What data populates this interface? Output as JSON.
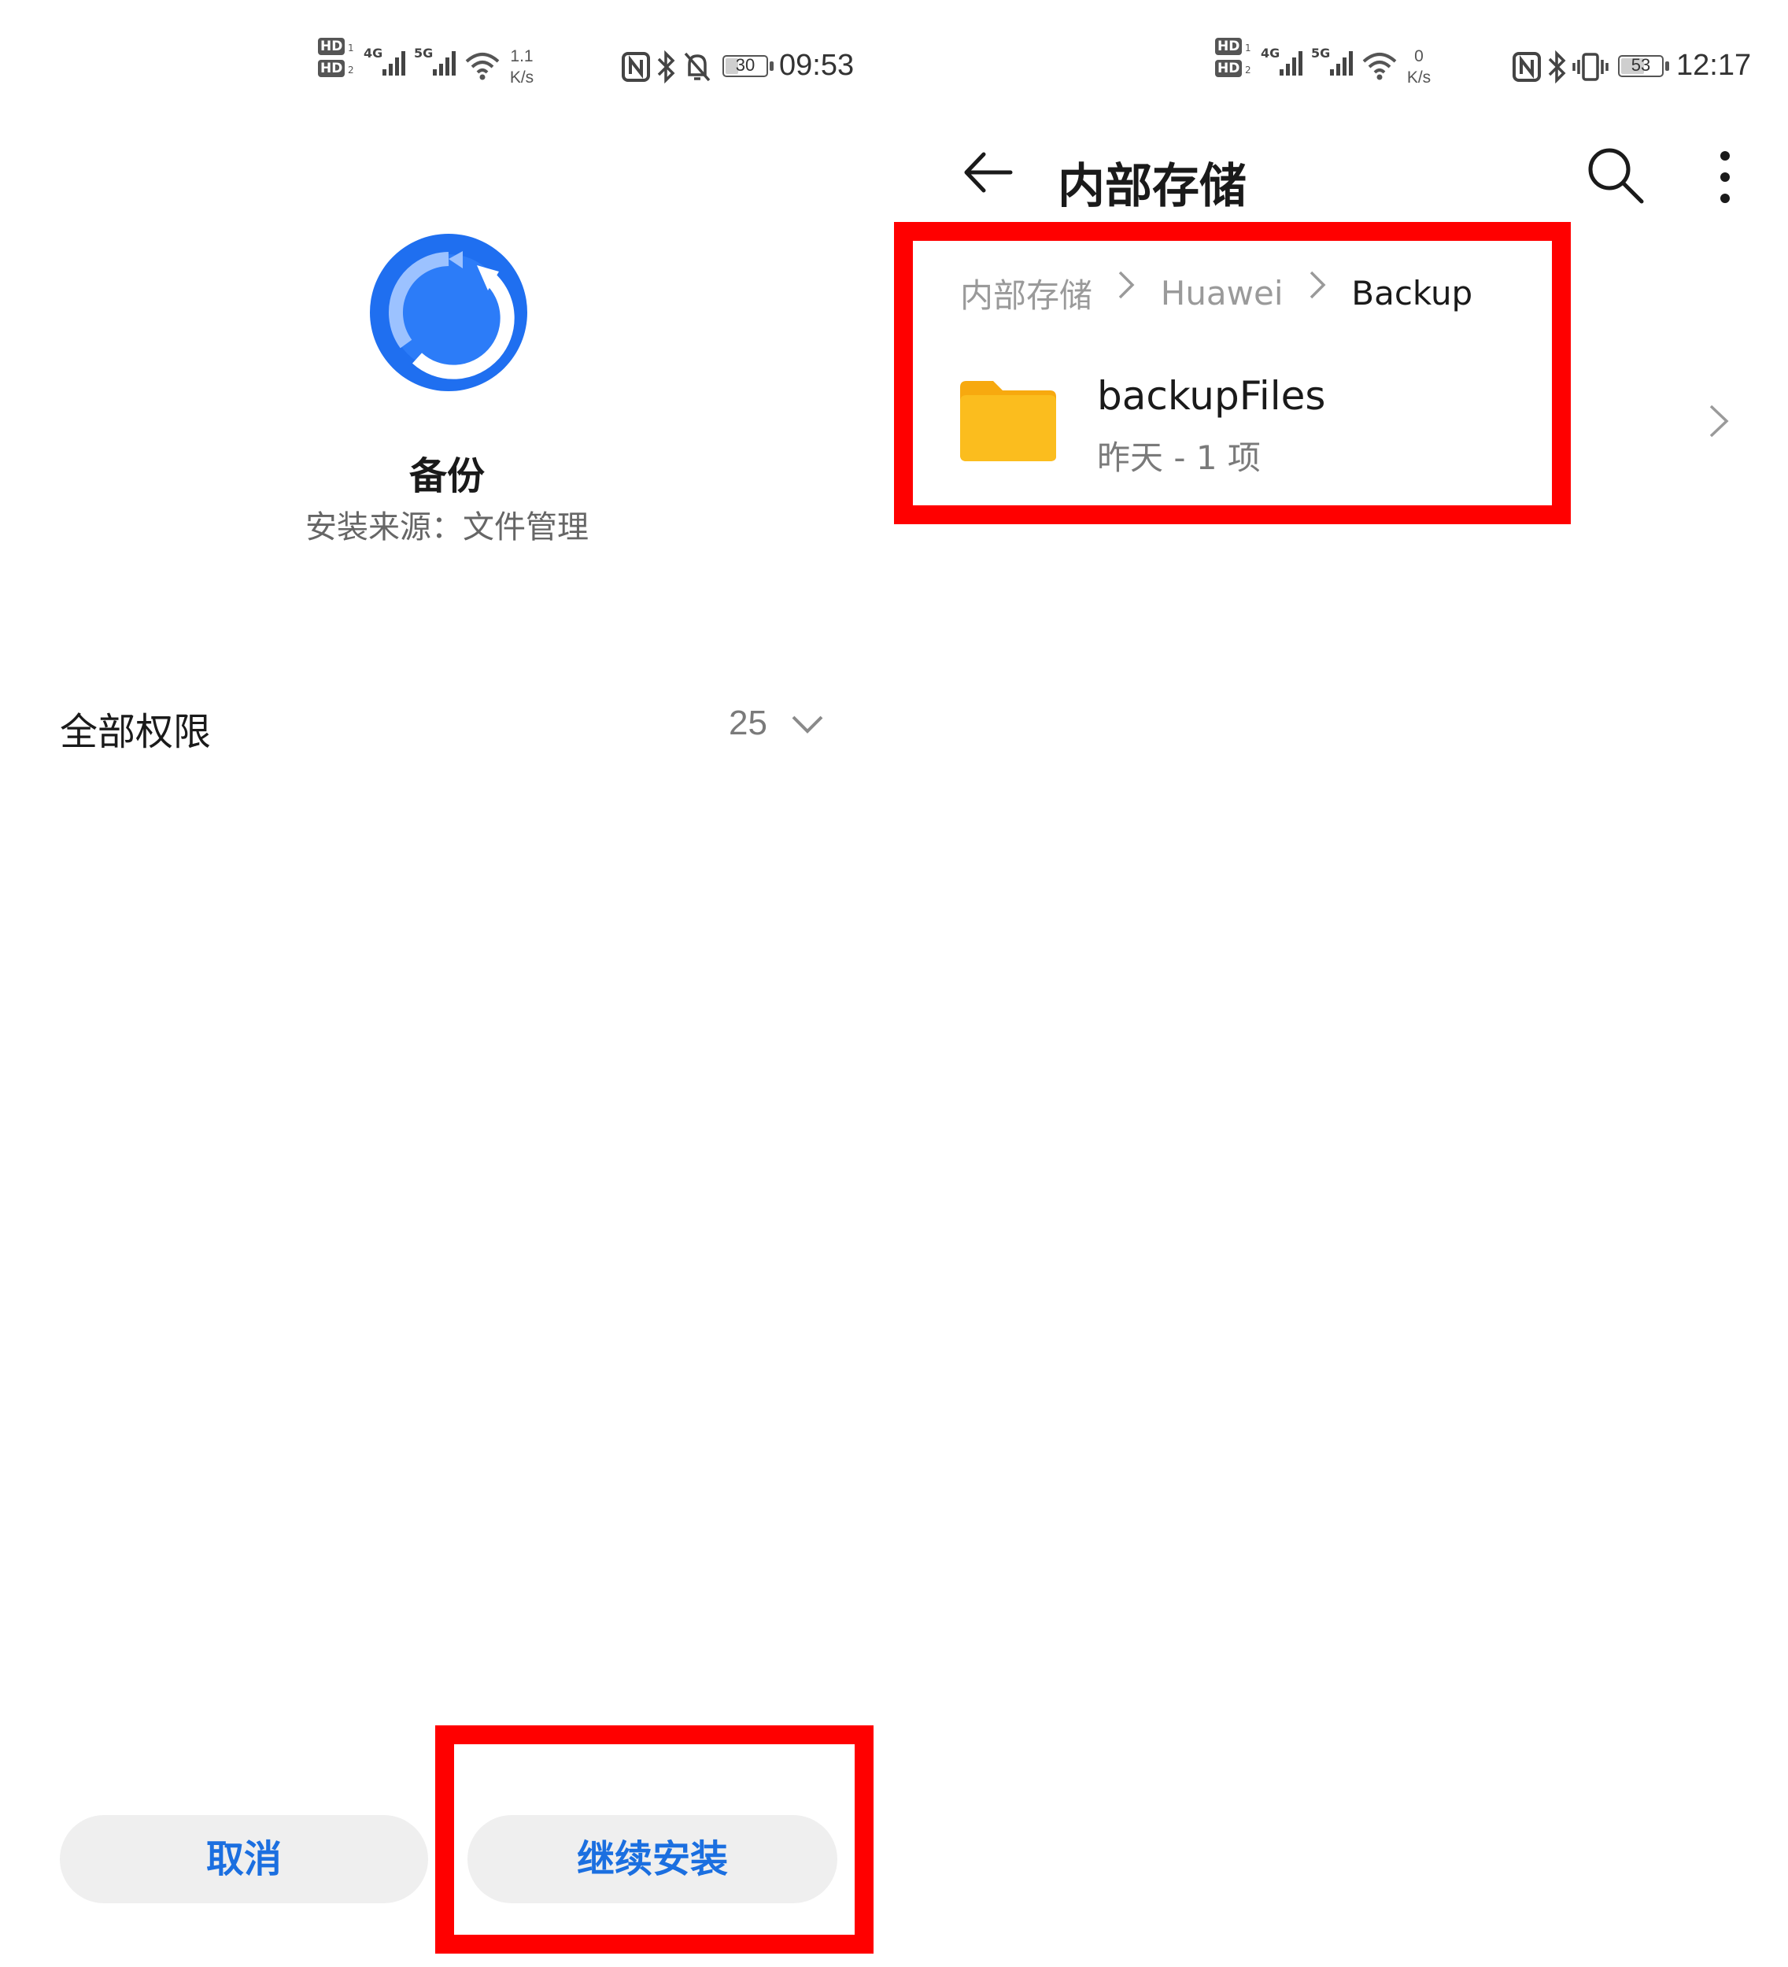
{
  "left": {
    "status_bar": {
      "hd1": "HD",
      "hd2": "HD",
      "sim1_gen": "4G",
      "sim2_gen": "5G",
      "speed_value": "1.1",
      "speed_unit": "K/s",
      "battery": "30",
      "time": "09:53"
    },
    "app": {
      "name": "备份",
      "source": "安装来源：文件管理",
      "icon": "backup-sync-icon",
      "icon_color": "#1f6ff0"
    },
    "permissions": {
      "label": "全部权限",
      "count": "25"
    },
    "buttons": {
      "cancel_label": "取消",
      "continue_label": "继续安装"
    }
  },
  "right": {
    "status_bar": {
      "hd1": "HD",
      "hd2": "HD",
      "sim1_gen": "4G",
      "sim2_gen": "5G",
      "speed_value": "0",
      "speed_unit": "K/s",
      "battery": "53",
      "time": "12:17"
    },
    "header": {
      "title": "内部存储"
    },
    "breadcrumb": {
      "items": [
        "内部存储",
        "Huawei",
        "Backup"
      ]
    },
    "folder": {
      "name": "backupFiles",
      "meta": "昨天 - 1 项",
      "icon_color": "#fbbd1e"
    }
  },
  "colors": {
    "accent_blue": "#1b6fe0",
    "highlight_red": "#ff0000",
    "button_bg": "#efefef"
  }
}
